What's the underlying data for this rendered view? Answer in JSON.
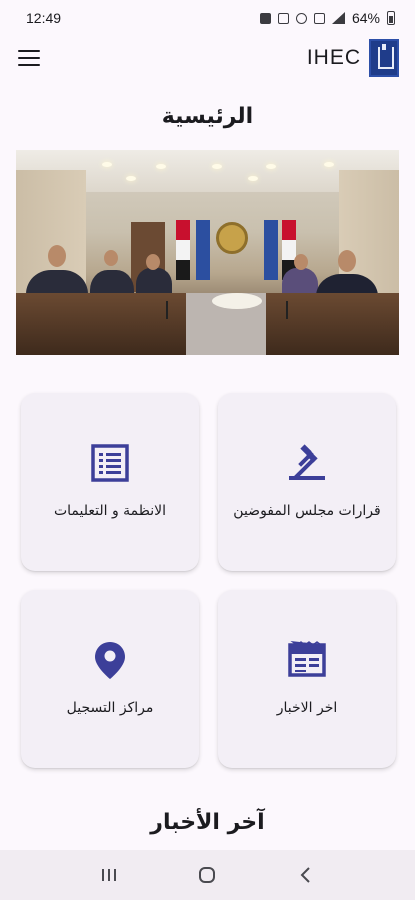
{
  "status": {
    "time": "12:49",
    "battery": "64%"
  },
  "app_bar": {
    "brand": "IHEC",
    "menu_icon": "hamburger-menu-icon",
    "logo": "ihec-logo"
  },
  "main": {
    "title": "الرئيسية",
    "hero_image": "board-meeting-photo",
    "cards": [
      {
        "label": "قرارات مجلس المفوضين",
        "icon": "gavel-icon"
      },
      {
        "label": "الانظمة و التعليمات",
        "icon": "list-document-icon"
      },
      {
        "label": "اخر الاخبار",
        "icon": "newspaper-icon"
      },
      {
        "label": "مراكز التسجيل",
        "icon": "location-pin-icon"
      }
    ],
    "news_title": "آخر الأخبار"
  },
  "nav": {
    "recents": "recents-icon",
    "home": "home-icon",
    "back": "back-icon"
  },
  "colors": {
    "accent": "#3c3f99",
    "background": "#fcf8fd",
    "card": "#f3eff6"
  }
}
